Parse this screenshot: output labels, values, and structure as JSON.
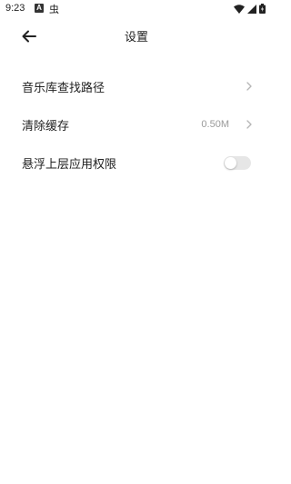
{
  "status_bar": {
    "time": "9:23",
    "indicator_a": "A",
    "bug_glyph": "虫",
    "icons": [
      "wifi-icon",
      "signal-icon",
      "battery-icon"
    ]
  },
  "app_bar": {
    "back_icon": "arrow-left-icon",
    "title": "设置"
  },
  "settings": {
    "items": [
      {
        "label": "音乐库查找路径",
        "value": "",
        "control": "chevron"
      },
      {
        "label": "清除缓存",
        "value": "0.50M",
        "control": "chevron"
      },
      {
        "label": "悬浮上层应用权限",
        "value": "",
        "control": "toggle",
        "toggle_on": false
      }
    ]
  },
  "colors": {
    "background": "#ffffff",
    "text": "#222222",
    "secondary_text": "#9a9a9a",
    "toggle_off_track": "#e6e6e6"
  }
}
